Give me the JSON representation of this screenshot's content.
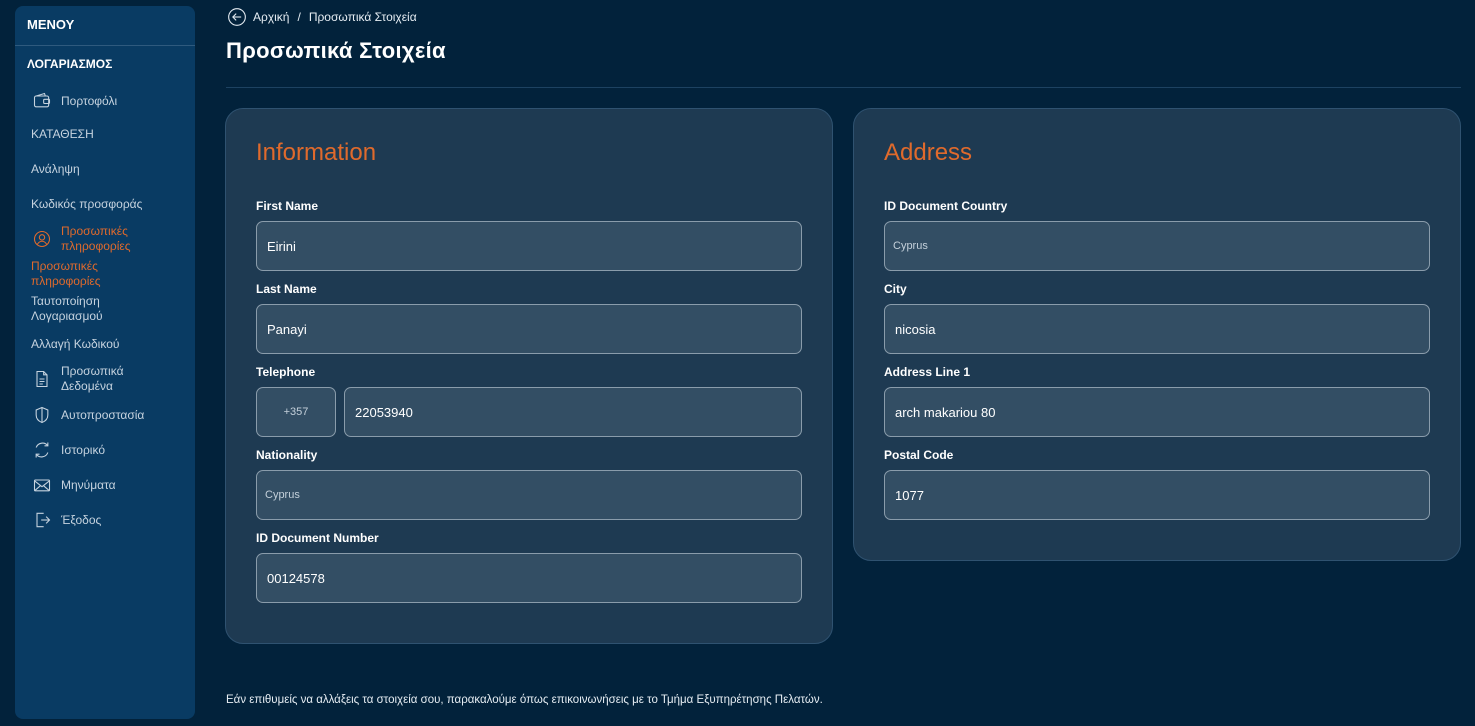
{
  "sidebar": {
    "header": "ΜΕΝΟΥ",
    "section": "ΛΟΓΑΡΙΑΣΜΟΣ",
    "items": [
      {
        "label": "Πορτοφόλι",
        "icon": "wallet-icon"
      },
      {
        "label": "ΚΑΤΑΘΕΣΗ"
      },
      {
        "label": "Ανάληψη"
      },
      {
        "label": "Κωδικός προσφοράς"
      },
      {
        "label": "Προσωπικές πληροφορίες",
        "icon": "user-icon"
      },
      {
        "label": "Προσωπικές πληροφορίες"
      },
      {
        "label": "Ταυτοποίηση Λογαριασμού"
      },
      {
        "label": "Αλλαγή Κωδικού"
      },
      {
        "label": "Προσωπικά Δεδομένα",
        "icon": "document-icon"
      },
      {
        "label": "Αυτοπροστασία",
        "icon": "shield-icon"
      },
      {
        "label": "Ιστορικό",
        "icon": "history-icon"
      },
      {
        "label": "Μηνύματα",
        "icon": "envelope-icon"
      },
      {
        "label": "Έξοδος",
        "icon": "logout-icon"
      }
    ]
  },
  "breadcrumb": {
    "home": "Αρχική",
    "separator": "/",
    "current": "Προσωπικά Στοιχεία"
  },
  "page_title": "Προσωπικά Στοιχεία",
  "information": {
    "title": "Information",
    "first_name_label": "First Name",
    "first_name": "Eirini",
    "last_name_label": "Last Name",
    "last_name": "Panayi",
    "telephone_label": "Telephone",
    "phone_code": "+357",
    "phone_number": "22053940",
    "nationality_label": "Nationality",
    "nationality": "Cyprus",
    "id_number_label": "ID Document Number",
    "id_number": "00124578"
  },
  "address": {
    "title": "Address",
    "country_label": "ID Document Country",
    "country": "Cyprus",
    "city_label": "City",
    "city": "nicosia",
    "line1_label": "Address Line 1",
    "line1": "arch makariou 80",
    "postal_label": "Postal Code",
    "postal": "1077"
  },
  "footer_note": "Εάν επιθυμείς να αλλάξεις τα στοιχεία σου, παρακαλούμε όπως επικοινωνήσεις με το Τμήμα Εξυπηρέτησης Πελατών.",
  "colors": {
    "accent": "#e06a2c",
    "background": "#02223b",
    "sidebar": "#093b63",
    "card": "#1e3a52"
  }
}
